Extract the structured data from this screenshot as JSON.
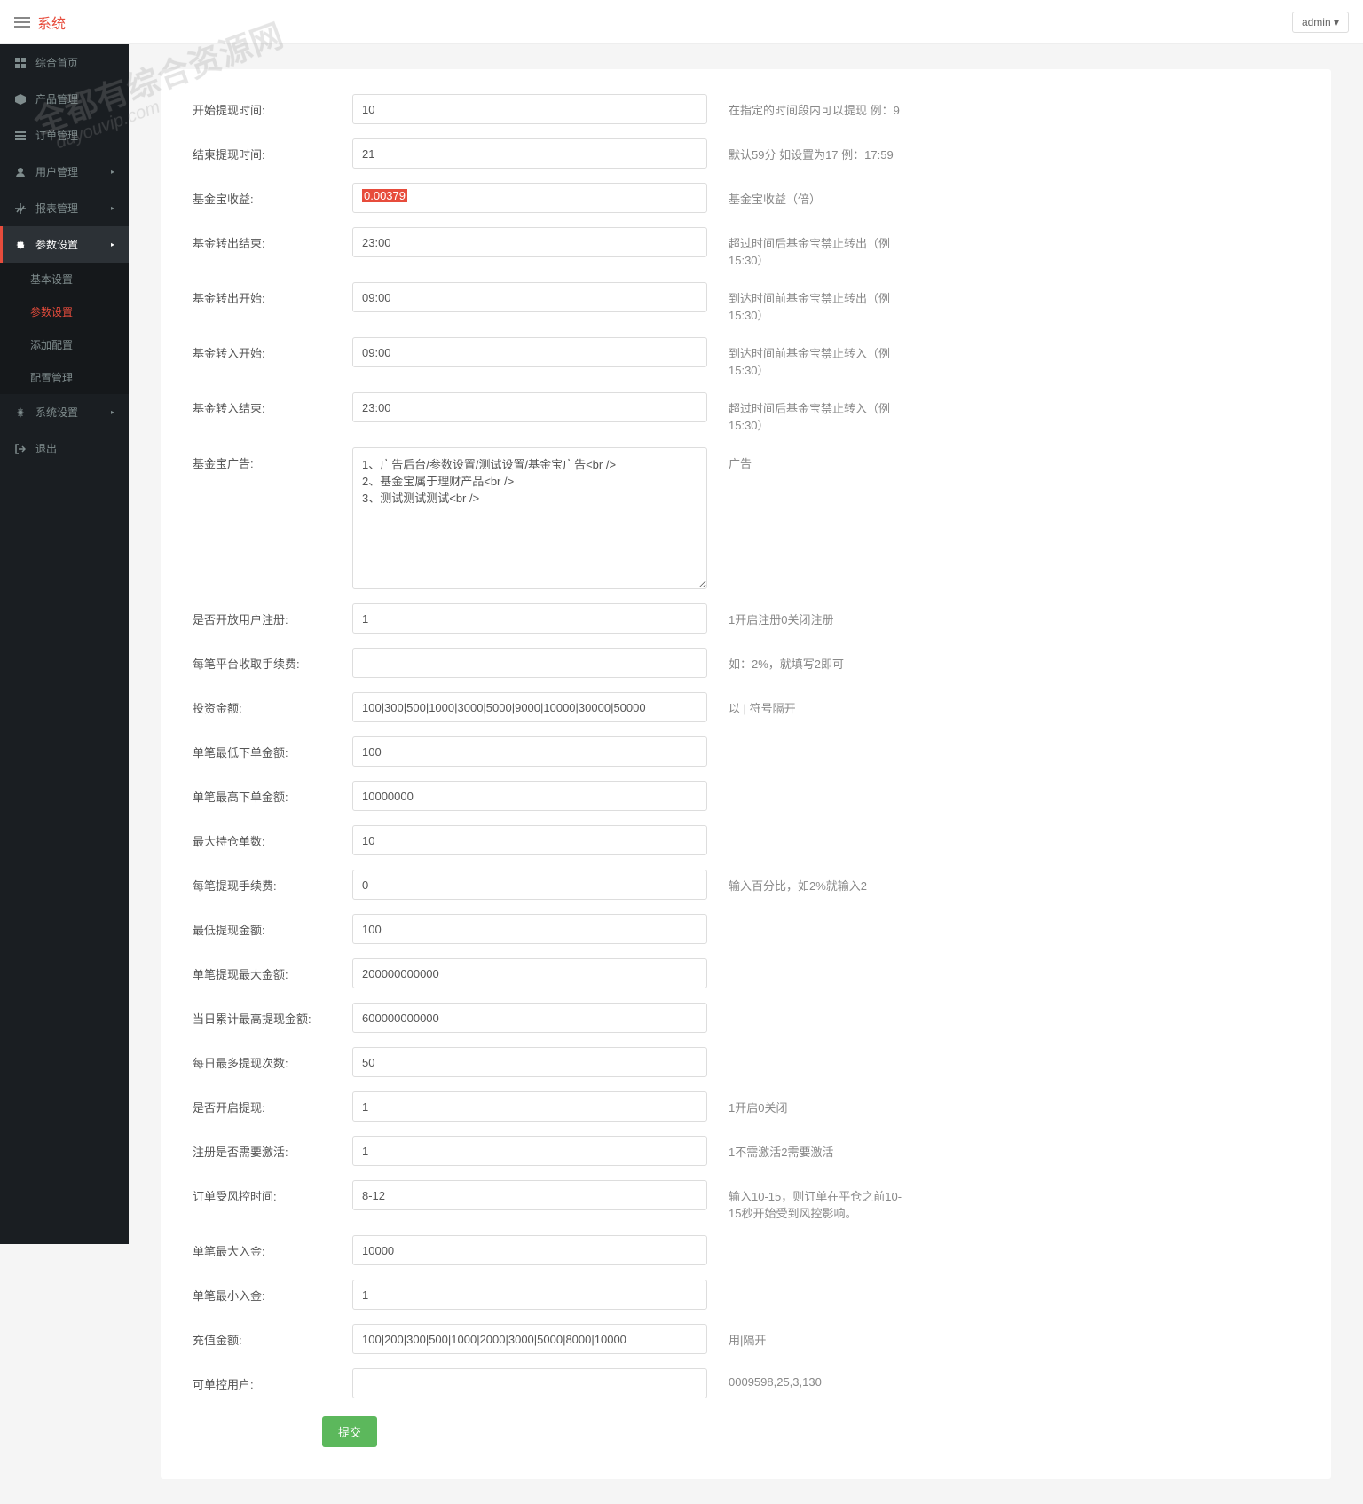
{
  "brand": "系统",
  "user": "admin",
  "watermark1": "全都有综合资源网",
  "watermark2": "duyouvip.com",
  "nav": [
    {
      "icon": "dashboard",
      "label": "综合首页",
      "arrow": false
    },
    {
      "icon": "cube",
      "label": "产品管理",
      "arrow": false
    },
    {
      "icon": "list",
      "label": "订单管理",
      "arrow": false
    },
    {
      "icon": "user",
      "label": "用户管理",
      "arrow": true
    },
    {
      "icon": "chart",
      "label": "报表管理",
      "arrow": true
    },
    {
      "icon": "cog",
      "label": "参数设置",
      "arrow": true,
      "active": true,
      "sub": [
        {
          "label": "基本设置"
        },
        {
          "label": "参数设置",
          "current": true
        },
        {
          "label": "添加配置"
        },
        {
          "label": "配置管理"
        }
      ]
    },
    {
      "icon": "gear",
      "label": "系统设置",
      "arrow": true
    },
    {
      "icon": "exit",
      "label": "退出",
      "arrow": false
    }
  ],
  "form": [
    {
      "label": "开始提现时间:",
      "value": "10",
      "help": "在指定的时间段内可以提现 例：9"
    },
    {
      "label": "结束提现时间:",
      "value": "21",
      "help": "默认59分 如设置为17 例：17:59"
    },
    {
      "label": "基金宝收益:",
      "value": "0.00379",
      "help": "基金宝收益（倍）",
      "highlight": true
    },
    {
      "label": "基金转出结束:",
      "value": "23:00",
      "help": "超过时间后基金宝禁止转出（例 15:30）"
    },
    {
      "label": "基金转出开始:",
      "value": "09:00",
      "help": "到达时间前基金宝禁止转出（例 15:30）"
    },
    {
      "label": "基金转入开始:",
      "value": "09:00",
      "help": "到达时间前基金宝禁止转入（例 15:30）"
    },
    {
      "label": "基金转入结束:",
      "value": "23:00",
      "help": "超过时间后基金宝禁止转入（例 15:30）"
    },
    {
      "label": "基金宝广告:",
      "value": "1、广告后台/参数设置/测试设置/基金宝广告<br />\n2、基金宝属于理财产品<br />\n3、测试测试测试<br />",
      "help": "广告",
      "textarea": true
    },
    {
      "label": "是否开放用户注册:",
      "value": "1",
      "help": "1开启注册0关闭注册"
    },
    {
      "label": "每笔平台收取手续费:",
      "value": "",
      "help": "如：2%，就填写2即可"
    },
    {
      "label": "投资金额:",
      "value": "100|300|500|1000|3000|5000|9000|10000|30000|50000",
      "help": "以 | 符号隔开"
    },
    {
      "label": "单笔最低下单金额:",
      "value": "100",
      "help": ""
    },
    {
      "label": "单笔最高下单金额:",
      "value": "10000000",
      "help": ""
    },
    {
      "label": "最大持仓单数:",
      "value": "10",
      "help": ""
    },
    {
      "label": "每笔提现手续费:",
      "value": "0",
      "help": "输入百分比，如2%就输入2"
    },
    {
      "label": "最低提现金额:",
      "value": "100",
      "help": ""
    },
    {
      "label": "单笔提现最大金额:",
      "value": "200000000000",
      "help": ""
    },
    {
      "label": "当日累计最高提现金额:",
      "value": "600000000000",
      "help": ""
    },
    {
      "label": "每日最多提现次数:",
      "value": "50",
      "help": ""
    },
    {
      "label": "是否开启提现:",
      "value": "1",
      "help": "1开启0关闭"
    },
    {
      "label": "注册是否需要激活:",
      "value": "1",
      "help": "1不需激活2需要激活"
    },
    {
      "label": "订单受风控时间:",
      "value": "8-12",
      "help": "输入10-15，则订单在平仓之前10-15秒开始受到风控影响。"
    },
    {
      "label": "单笔最大入金:",
      "value": "10000",
      "help": ""
    },
    {
      "label": "单笔最小入金:",
      "value": "1",
      "help": ""
    },
    {
      "label": "充值金额:",
      "value": "100|200|300|500|1000|2000|3000|5000|8000|10000",
      "help": "用|隔开"
    },
    {
      "label": "可单控用户:",
      "value": "",
      "help": "0009598,25,3,130"
    }
  ],
  "submit": "提交"
}
